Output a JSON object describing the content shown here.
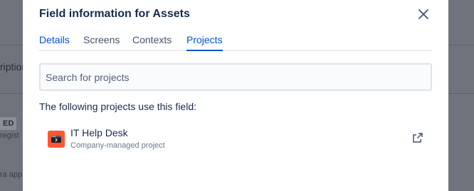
{
  "modal": {
    "title": "Field information for Assets",
    "tabs": [
      {
        "label": "Details"
      },
      {
        "label": "Screens"
      },
      {
        "label": "Contexts"
      },
      {
        "label": "Projects",
        "active": true
      }
    ],
    "search_placeholder": "Search for projects",
    "subheading": "The following projects use this field:",
    "projects": [
      {
        "name": "IT Help Desk",
        "type": "Company-managed project",
        "avatar_color": "#ff5630"
      }
    ]
  },
  "background": {
    "partial_text": "ription",
    "badge": "ED",
    "snippet_1": "regist",
    "snippet_2": "ra app"
  },
  "colors": {
    "accent": "#0052cc",
    "text": "#172b4d",
    "overlay": "#6f737b"
  },
  "icons": {
    "close": "close-icon",
    "external": "external-link-icon"
  }
}
